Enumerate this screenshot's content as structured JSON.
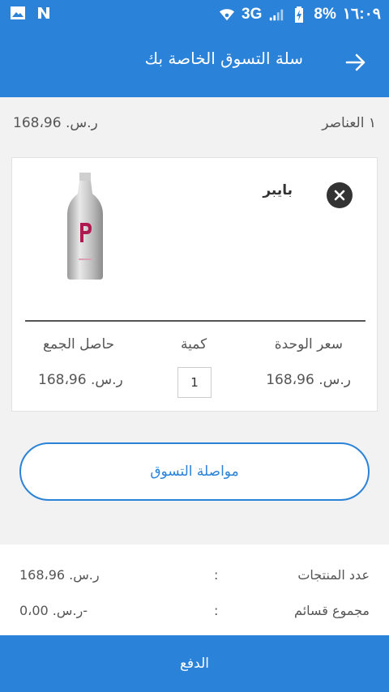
{
  "statusbar": {
    "icons_left": [
      "image-icon",
      "n-notification-icon"
    ],
    "network": "3G",
    "battery": "8%",
    "time": "١٦:٠٩"
  },
  "header": {
    "title": "سلة التسوق الخاصة بك",
    "back_icon": "arrow-right-icon",
    "color": "#2b82d9"
  },
  "summary_top": {
    "items_count": "١ العناصر",
    "total": "ر.س. 168،96"
  },
  "cart_item": {
    "name": "بايبر",
    "remove_icon": "close-circle-icon",
    "image_icon": "bottle-icon",
    "unit_price_label": "سعر الوحدة",
    "quantity_label": "كمية",
    "subtotal_label": "حاصل الجمع",
    "unit_price": "ر.س. 168،96",
    "quantity": "1",
    "subtotal": "ر.س. 168،96"
  },
  "continue_shopping": "مواصلة التسوق",
  "order_summary": {
    "products_label": "عدد المنتجات",
    "products_value": "ر.س. 168،96",
    "coupons_label": "مجموع قسائم",
    "coupons_value": "-ر.س. 0،00",
    "separator": ":"
  },
  "pay_button": "الدفع"
}
